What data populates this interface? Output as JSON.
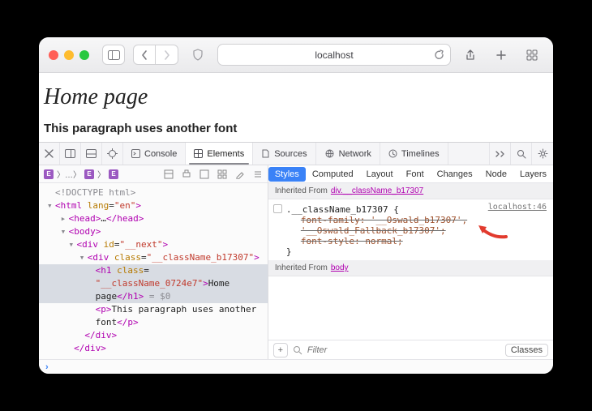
{
  "titlebar": {
    "url_text": "localhost"
  },
  "page": {
    "heading": "Home page",
    "paragraph": "This paragraph uses another font"
  },
  "devtools": {
    "tabs": {
      "console": "Console",
      "elements": "Elements",
      "sources": "Sources",
      "network": "Network",
      "timelines": "Timelines"
    },
    "dom": {
      "doctype": "<!DOCTYPE html>",
      "html_open": "<html lang=\"en\">",
      "head": "<head>…</head>",
      "body_open": "<body>",
      "div_next": "<div id=\"__next\">",
      "div_b17307": "<div class=\"__className_b17307\">",
      "h1_open_1": "<h1 class=",
      "h1_open_2": "\"__className_0724e7\">",
      "h1_text_a": "Home",
      "h1_text_b": "page",
      "h1_close": "</h1>",
      "eq0": " = $0",
      "p_open": "<p>",
      "p_text": "This paragraph uses another font",
      "p_close": "</p>",
      "div_close": "</div>"
    },
    "styles": {
      "tabs": {
        "styles": "Styles",
        "computed": "Computed",
        "layout": "Layout",
        "font": "Font",
        "changes": "Changes",
        "node": "Node",
        "layers": "Layers"
      },
      "inherited_from": "Inherited From",
      "inherited_selector": "div.__className_b17307",
      "rule_selector": ".__className_b17307",
      "rule_open": " {",
      "rule_close": "}",
      "decl1": "font-family: '__Oswald_b17307',",
      "decl1b": "'__Oswald_Fallback_b17307';",
      "decl2": "font-style: normal;",
      "source": "localhost:46",
      "inherited_from_body_label": "Inherited From",
      "inherited_from_body": "body",
      "filter_placeholder": "Filter",
      "classes": "Classes"
    }
  }
}
